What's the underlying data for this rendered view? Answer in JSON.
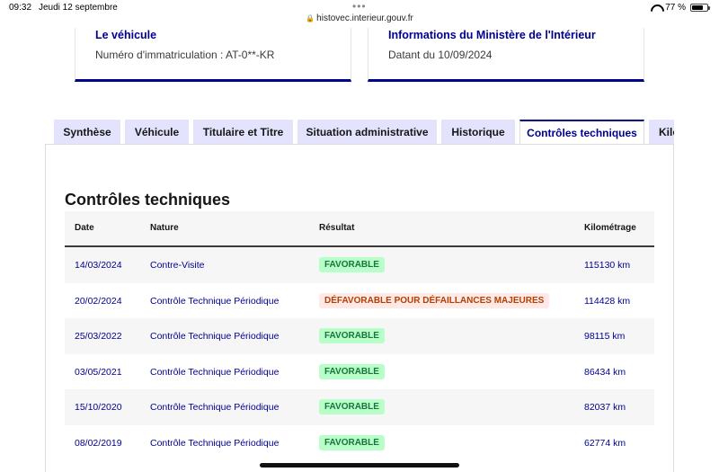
{
  "status_bar": {
    "time": "09:32",
    "date": "Jeudi 12 septembre",
    "dots": "•••",
    "url": "histovec.interieur.gouv.fr",
    "battery": "77 %",
    "battery_level": 0.77
  },
  "cards": {
    "vehicle_title": "Le véhicule",
    "vehicle_text": "Numéro d'immatriculation : AT-0**-KR",
    "ministry_title": "Informations du Ministère de l'Intérieur",
    "ministry_text": "Datant du 10/09/2024"
  },
  "tabs": [
    {
      "label": "Synthèse"
    },
    {
      "label": "Véhicule"
    },
    {
      "label": "Titulaire et Titre"
    },
    {
      "label": "Situation administrative"
    },
    {
      "label": "Historique"
    },
    {
      "label": "Contrôles techniques",
      "active": true
    },
    {
      "label": "Kilométrage"
    }
  ],
  "section": {
    "title": "Contrôles techniques",
    "columns": [
      "Date",
      "Nature",
      "Résultat",
      "Kilométrage"
    ],
    "rows": [
      {
        "date": "14/03/2024",
        "nature": "Contre-Visite",
        "result": "FAVORABLE",
        "status": "ok",
        "km": "115130 km"
      },
      {
        "date": "20/02/2024",
        "nature": "Contrôle Technique Périodique",
        "result": "DÉFAVORABLE POUR DÉFAILLANCES MAJEURES",
        "status": "ko",
        "km": "114428 km"
      },
      {
        "date": "25/03/2022",
        "nature": "Contrôle Technique Périodique",
        "result": "FAVORABLE",
        "status": "ok",
        "km": "98115 km"
      },
      {
        "date": "03/05/2021",
        "nature": "Contrôle Technique Périodique",
        "result": "FAVORABLE",
        "status": "ok",
        "km": "86434 km"
      },
      {
        "date": "15/10/2020",
        "nature": "Contrôle Technique Périodique",
        "result": "FAVORABLE",
        "status": "ok",
        "km": "82037 km"
      },
      {
        "date": "08/02/2019",
        "nature": "Contrôle Technique Périodique",
        "result": "FAVORABLE",
        "status": "ok",
        "km": "62774 km"
      }
    ]
  },
  "colors": {
    "accent": "#000091",
    "tab_bg": "#e3e3fd",
    "ok_bg": "#b8fec9",
    "ok_text": "#18753c",
    "ko_bg": "#ffe9e6",
    "ko_text": "#b34000"
  }
}
